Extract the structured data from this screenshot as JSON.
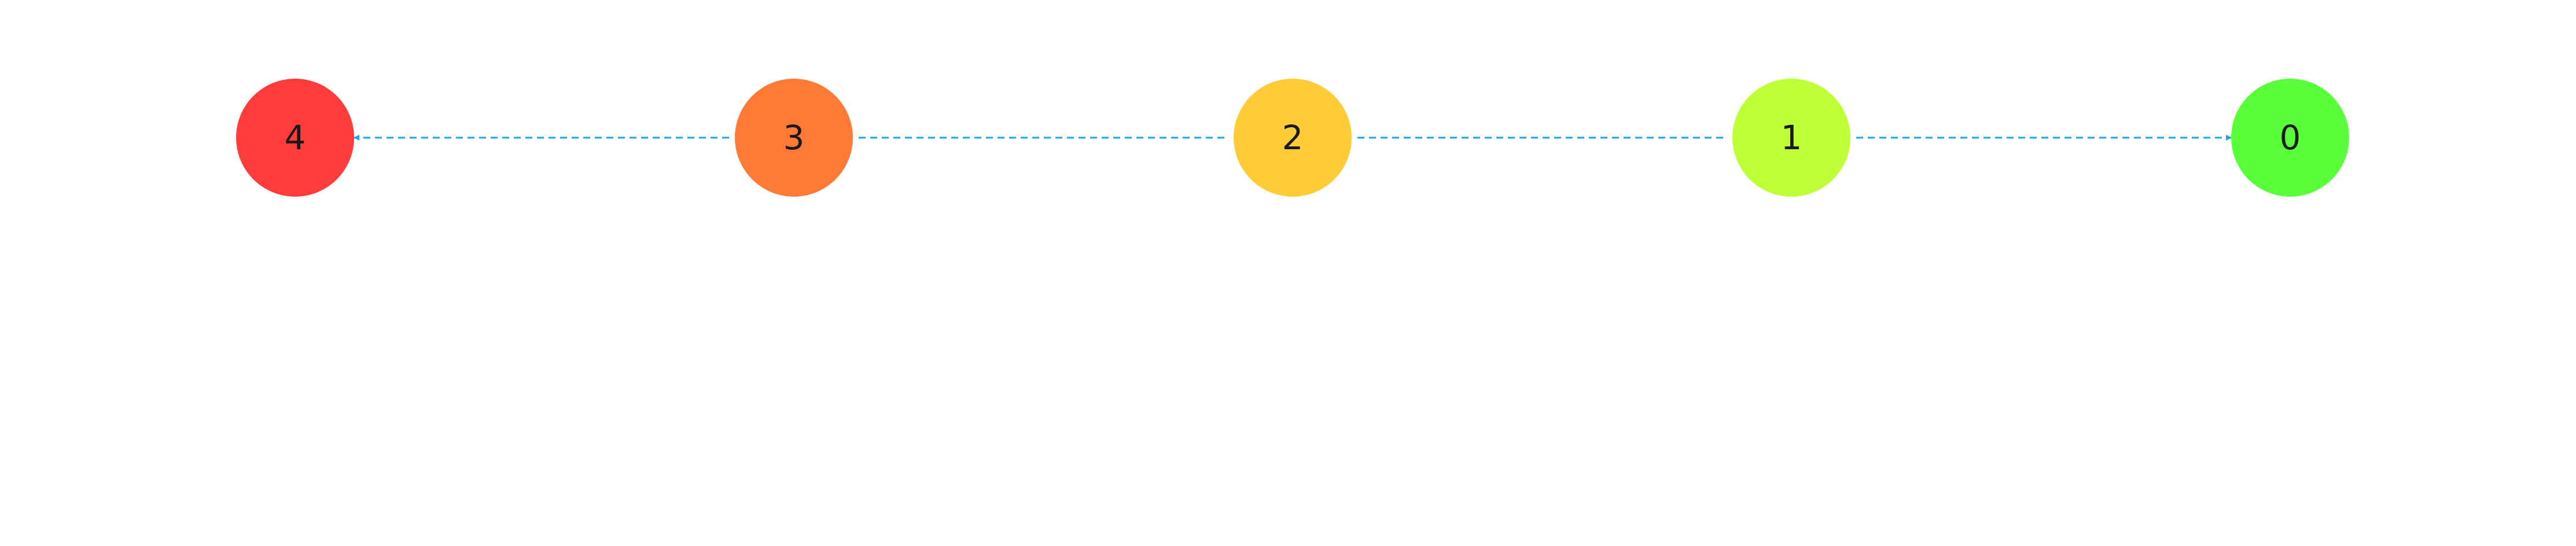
{
  "diagram": {
    "edge_color": "#1aa3e8",
    "nodes": [
      {
        "id": "n4",
        "label": "4",
        "color": "#ff3b3b"
      },
      {
        "id": "n3",
        "label": "3",
        "color": "#ff7a36"
      },
      {
        "id": "n2",
        "label": "2",
        "color": "#ffcb36"
      },
      {
        "id": "n1",
        "label": "1",
        "color": "#bfff36"
      },
      {
        "id": "n0",
        "label": "0",
        "color": "#59ff3b"
      }
    ],
    "edges": [
      {
        "from": "n3",
        "to": "n4",
        "style": "dashed",
        "arrow": "to"
      },
      {
        "from": "n3",
        "to": "n2",
        "style": "dashed",
        "arrow": "none"
      },
      {
        "from": "n2",
        "to": "n1",
        "style": "dashed",
        "arrow": "none"
      },
      {
        "from": "n1",
        "to": "n0",
        "style": "dashed",
        "arrow": "to"
      }
    ]
  }
}
